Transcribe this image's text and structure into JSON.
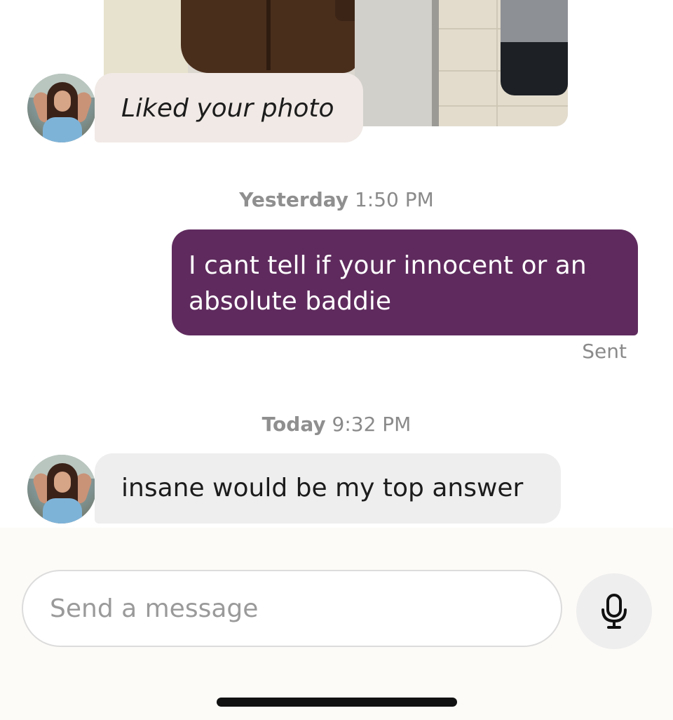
{
  "conversation": {
    "liked_message": {
      "text": "Liked your photo"
    },
    "timestamp_1": {
      "day": "Yesterday",
      "time": "1:50 PM"
    },
    "sent_message": {
      "text": "I cant tell if your innocent or an absolute baddie",
      "status": "Sent"
    },
    "timestamp_2": {
      "day": "Today",
      "time": "9:32 PM"
    },
    "received_message": {
      "text": "insane would be my top answer"
    }
  },
  "composer": {
    "placeholder": "Send a message",
    "mic_icon": "microphone-icon"
  },
  "colors": {
    "sent_bubble": "#5f2b5e",
    "received_bubble": "#eeeeee",
    "liked_bubble": "#f0e9e5",
    "composer_bg": "#fdfbf8"
  }
}
